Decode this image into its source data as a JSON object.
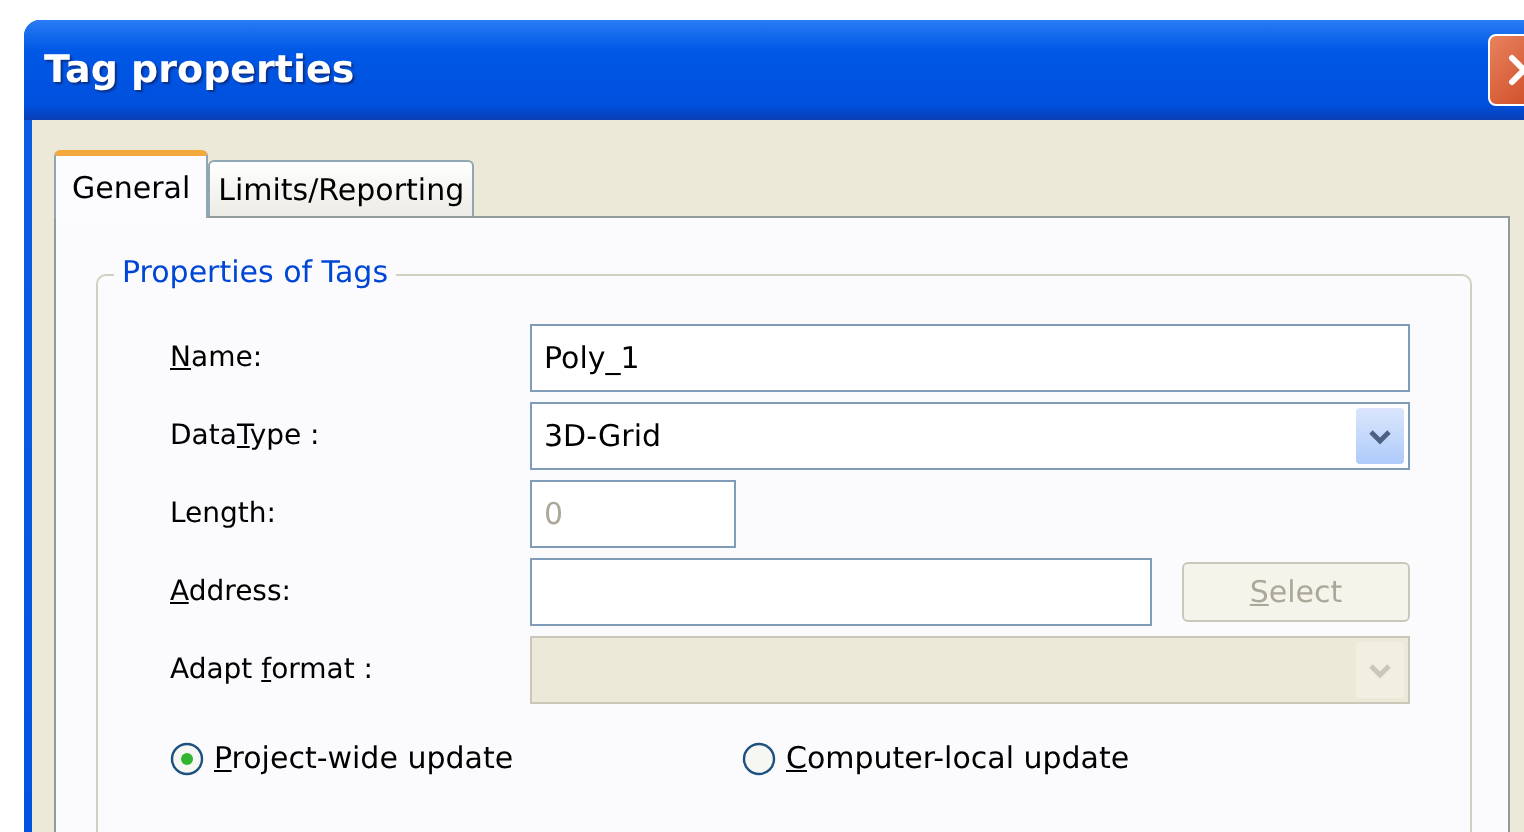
{
  "window": {
    "title": "Tag properties"
  },
  "tabs": [
    {
      "label": "General",
      "selected": true
    },
    {
      "label": "Limits/Reporting",
      "selected": false
    }
  ],
  "group": {
    "title": "Properties of Tags"
  },
  "fields": [
    {
      "kind": "text",
      "label": {
        "key": "N",
        "post": "ame:"
      },
      "value": "Poly_1",
      "disabled": false
    },
    {
      "kind": "combo",
      "label": {
        "pre": "Data",
        "key": "T",
        "post": "ype :"
      },
      "value": "3D-Grid",
      "disabled": false
    },
    {
      "kind": "number",
      "label": {
        "pre": "Length:"
      },
      "value": "0",
      "disabled": true
    },
    {
      "kind": "text_with_button",
      "label": {
        "key": "A",
        "post": "ddress:"
      },
      "disabled": false,
      "button": {
        "key": "S",
        "post": "elect",
        "disabled": true
      }
    },
    {
      "kind": "combo",
      "label": {
        "pre": "Adapt ",
        "key": "f",
        "post": "ormat :"
      },
      "disabled": true
    }
  ],
  "radios": [
    {
      "label": {
        "key": "P",
        "post": "roject-wide update"
      },
      "selected": true
    },
    {
      "label": {
        "key": "C",
        "post": "omputer-local update"
      },
      "selected": false
    }
  ]
}
